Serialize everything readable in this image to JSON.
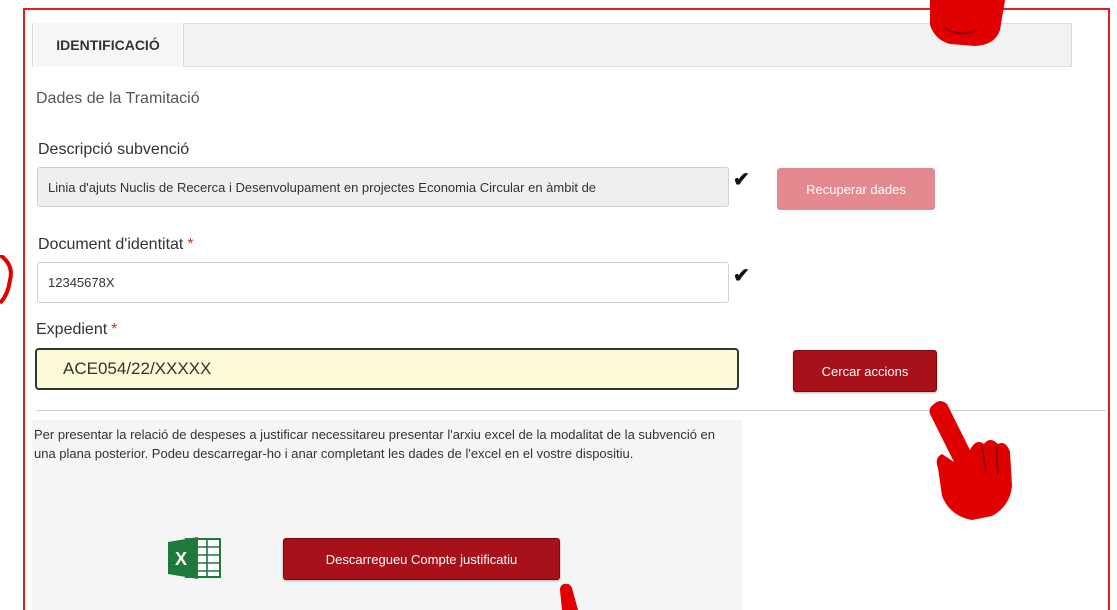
{
  "tabs": [
    {
      "label": "IDENTIFICACIÓ",
      "active": true
    }
  ],
  "section_title": "Dades de la Tramitació",
  "form": {
    "description": {
      "label": "Descripció subvenció",
      "value": "Linia d'ajuts Nuclis de Recerca i Desenvolupament en projectes Economia Circular en àmbit de"
    },
    "recover_button": "Recuperar dades",
    "identity": {
      "label": "Document d'identitat",
      "required_mark": "*",
      "value": "12345678X"
    },
    "expedient": {
      "label": "Expedient",
      "required_mark": "*",
      "value": "ACE054/22/XXXXX"
    },
    "search_button": "Cercar accions"
  },
  "info": {
    "text": "Per presentar la relació de despeses a justificar necessitareu presentar l'arxiu excel de la modalitat de la subvenció en una plana posterior. Podeu descarregar-ho i anar completant les dades de l'excel en el vostre dispositiu.",
    "download_button": "Descarregueu Compte justificatiu",
    "icon": "excel-icon"
  },
  "colors": {
    "frame": "#e02020",
    "primary_button": "#a8101a",
    "disabled_button": "#e48a8f",
    "active_field": "#fdfbd7",
    "pointer_hand": "#e00000"
  }
}
